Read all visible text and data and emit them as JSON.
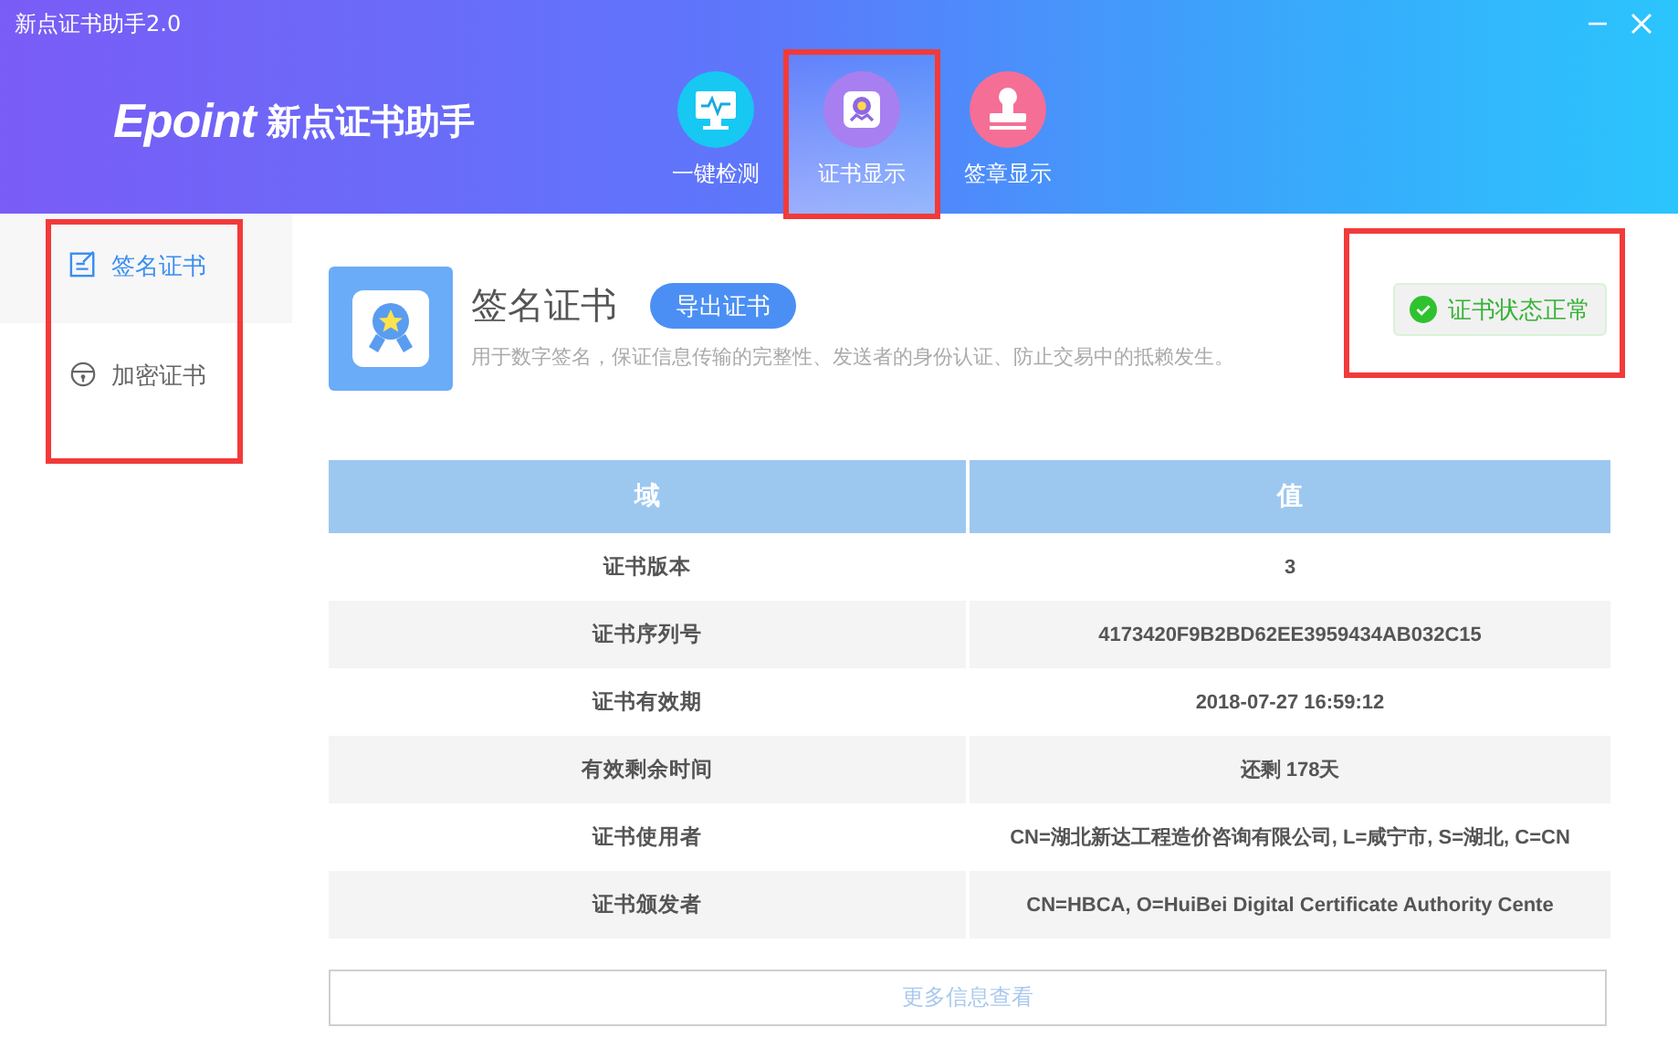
{
  "window": {
    "title": "新点证书助手2.0"
  },
  "brand": {
    "logo": "Epoint",
    "name": "新点证书助手"
  },
  "tabs": [
    {
      "label": "一键检测",
      "kind": "monitor",
      "selected": false,
      "highlighted": false
    },
    {
      "label": "证书显示",
      "kind": "certificate",
      "selected": true,
      "highlighted": true
    },
    {
      "label": "签章显示",
      "kind": "stamp",
      "selected": false,
      "highlighted": false
    }
  ],
  "sidebar": {
    "highlighted": true,
    "items": [
      {
        "label": "签名证书",
        "kind": "sign",
        "selected": true
      },
      {
        "label": "加密证书",
        "kind": "lock",
        "selected": false
      }
    ]
  },
  "certificate": {
    "title": "签名证书",
    "export_button": "导出证书",
    "description": "用于数字签名，保证信息传输的完整性、发送者的身份认证、防止交易中的抵赖发生。",
    "status": {
      "label": "证书状态正常",
      "ok": true,
      "highlighted": true
    }
  },
  "table": {
    "columns": [
      "域",
      "值"
    ],
    "rows": [
      {
        "field": "证书版本",
        "value": "3"
      },
      {
        "field": "证书序列号",
        "value": "4173420F9B2BD62EE3959434AB032C15"
      },
      {
        "field": "证书有效期",
        "value": "2018-07-27 16:59:12"
      },
      {
        "field": "有效剩余时间",
        "value": "还剩 178天"
      },
      {
        "field": "证书使用者",
        "value": "CN=湖北新达工程造价咨询有限公司, L=咸宁市, S=湖北, C=CN"
      },
      {
        "field": "证书颁发者",
        "value": "CN=HBCA, O=HuiBei Digital Certificate Authority Cente"
      }
    ]
  },
  "more_button": "更多信息查看"
}
